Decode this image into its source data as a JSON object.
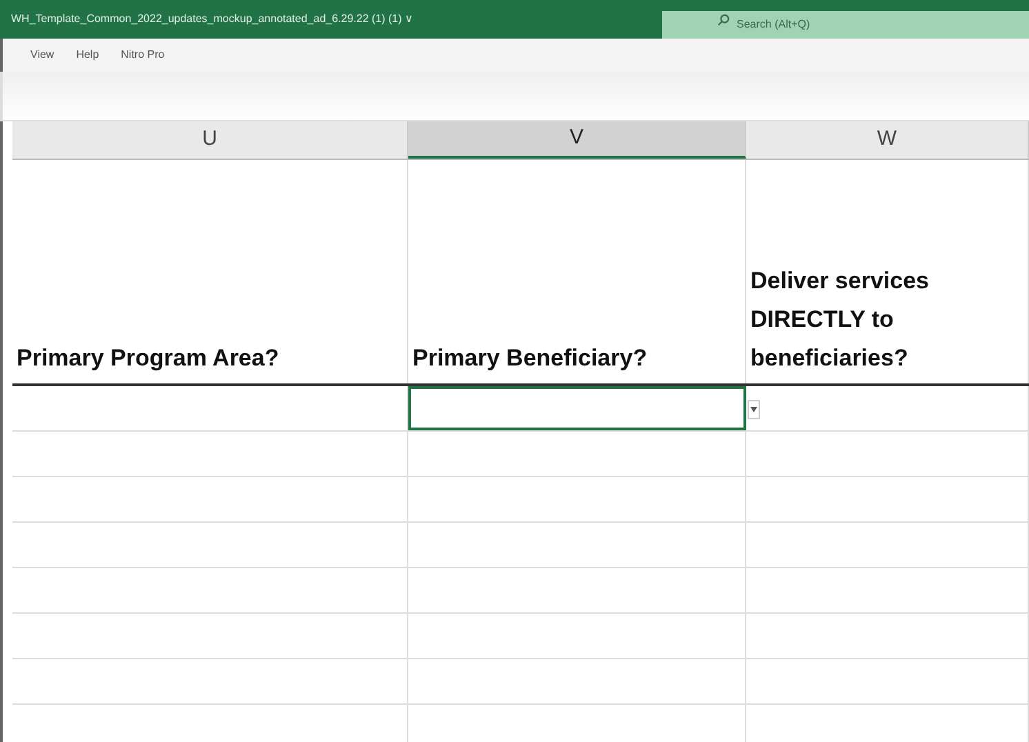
{
  "title_bar": {
    "title": "WH_Template_Common_2022_updates_mockup_annotated_ad_6.29.22 (1) (1) ∨",
    "search": {
      "placeholder": "Search (Alt+Q)"
    }
  },
  "menu": [
    {
      "label": "View"
    },
    {
      "label": "Help"
    },
    {
      "label": "Nitro Pro"
    }
  ],
  "columns": [
    {
      "letter": "U",
      "heading": "Primary Program Area?",
      "selected": false
    },
    {
      "letter": "V",
      "heading": "Primary Beneficiary?",
      "selected": true
    },
    {
      "letter": "W",
      "heading": "Deliver services DIRECTLY to beneficiaries?",
      "selected": false
    }
  ],
  "rows": [
    {
      "cells": [
        {
          "selected": false
        },
        {
          "selected": true,
          "has_dropdown": true
        },
        {
          "selected": false
        }
      ]
    },
    {
      "cells": [
        {
          "selected": false
        },
        {
          "selected": false
        },
        {
          "selected": false
        }
      ]
    },
    {
      "cells": [
        {
          "selected": false
        },
        {
          "selected": false
        },
        {
          "selected": false
        }
      ]
    },
    {
      "cells": [
        {
          "selected": false
        },
        {
          "selected": false
        },
        {
          "selected": false
        }
      ]
    },
    {
      "cells": [
        {
          "selected": false
        },
        {
          "selected": false
        },
        {
          "selected": false
        }
      ]
    },
    {
      "cells": [
        {
          "selected": false
        },
        {
          "selected": false
        },
        {
          "selected": false
        }
      ]
    },
    {
      "cells": [
        {
          "selected": false
        },
        {
          "selected": false
        },
        {
          "selected": false
        }
      ]
    },
    {
      "cells": [
        {
          "selected": false
        },
        {
          "selected": false
        },
        {
          "selected": false
        }
      ]
    }
  ]
}
